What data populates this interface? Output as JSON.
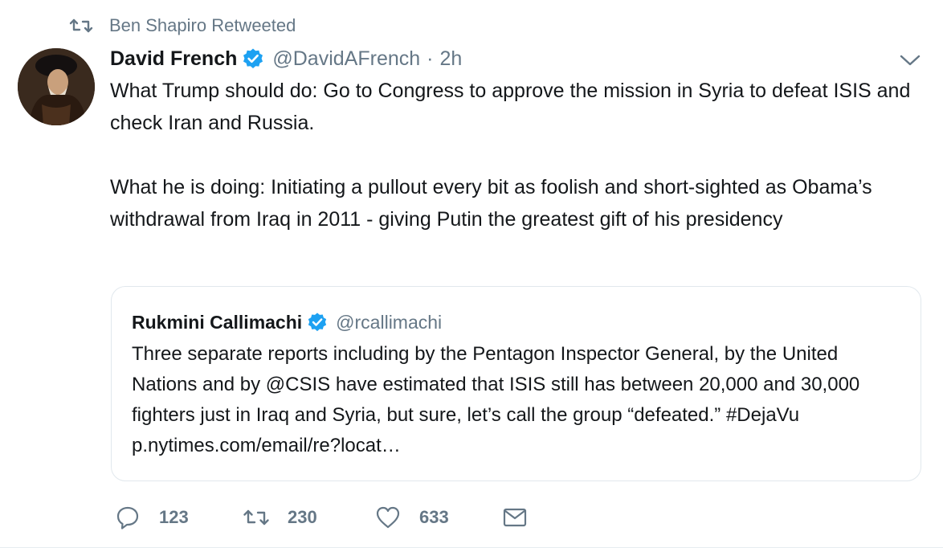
{
  "retweet_context": {
    "icon": "retweet-icon",
    "text": "Ben Shapiro Retweeted"
  },
  "tweet": {
    "author": {
      "name": "David French",
      "handle": "@DavidAFrench",
      "verified": true,
      "avatar_icon": "avatar-portrait"
    },
    "separator": "·",
    "time": "2h",
    "caret_icon": "chevron-down-icon",
    "text": {
      "paragraph1": "What Trump should do: Go to Congress to approve the mission in Syria to defeat ISIS and check Iran and Russia.",
      "paragraph2": "What he is doing: Initiating a pullout every bit as foolish and short-sighted as Obama’s withdrawal from Iraq in 2011 - giving Putin the greatest gift of his presidency"
    }
  },
  "quote": {
    "author": {
      "name": "Rukmini Callimachi",
      "handle": "@rcallimachi",
      "verified": true
    },
    "text": "Three separate reports including by the Pentagon Inspector General, by the United Nations and by @CSIS have estimated that ISIS still has between 20,000 and 30,000 fighters just in Iraq and Syria, but sure, let’s call the group “defeated.” #DejaVu  p.nytimes.com/email/re?locat…"
  },
  "actions": {
    "reply": {
      "icon": "reply-icon",
      "count": "123"
    },
    "retweet": {
      "icon": "retweet-icon",
      "count": "230"
    },
    "like": {
      "icon": "heart-icon",
      "count": "633"
    },
    "dm": {
      "icon": "envelope-icon"
    }
  },
  "colors": {
    "text_primary": "#14171a",
    "text_secondary": "#657786",
    "verified_blue": "#1da1f2",
    "border": "#e1e8ed"
  }
}
